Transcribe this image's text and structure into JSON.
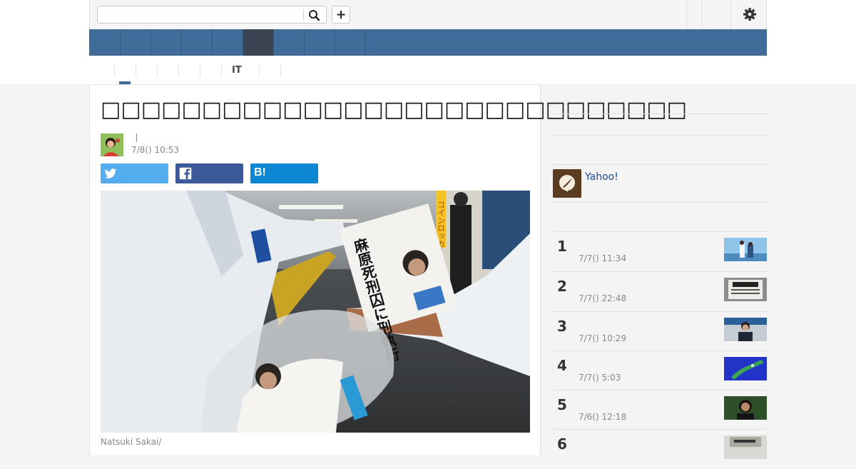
{
  "header": {
    "search_placeholder": "",
    "search_value": ""
  },
  "subnav": {
    "it_label": "IT"
  },
  "article": {
    "title": "□□□□□□□□□□□□□□□□□□□□□□□□□□□□□",
    "author_name": "",
    "date": "7/8() 10:53",
    "share": {
      "twitter": "",
      "facebook": "",
      "hatena_text": "B!"
    },
    "photo_newspaper_headline": "麻原死刑囚に刑執行",
    "photo_sign": "コインロッカー",
    "caption": "Natsuki Sakai/"
  },
  "sidebar": {
    "yahoo_label": "Yahoo!",
    "ranking": [
      {
        "rank": "1",
        "date": "7/7() 11:34"
      },
      {
        "rank": "2",
        "date": "7/7() 22:48"
      },
      {
        "rank": "3",
        "date": "7/7() 10:29"
      },
      {
        "rank": "4",
        "date": "7/7() 5:03"
      },
      {
        "rank": "5",
        "date": "7/6() 12:18"
      },
      {
        "rank": "6",
        "date": ""
      }
    ]
  },
  "colors": {
    "nav_blue": "#3f6c99",
    "nav_active": "#3b4453",
    "twitter": "#55acee",
    "facebook": "#3b5998",
    "hatena": "#0e87d3",
    "link_blue": "#1a4c8c"
  }
}
